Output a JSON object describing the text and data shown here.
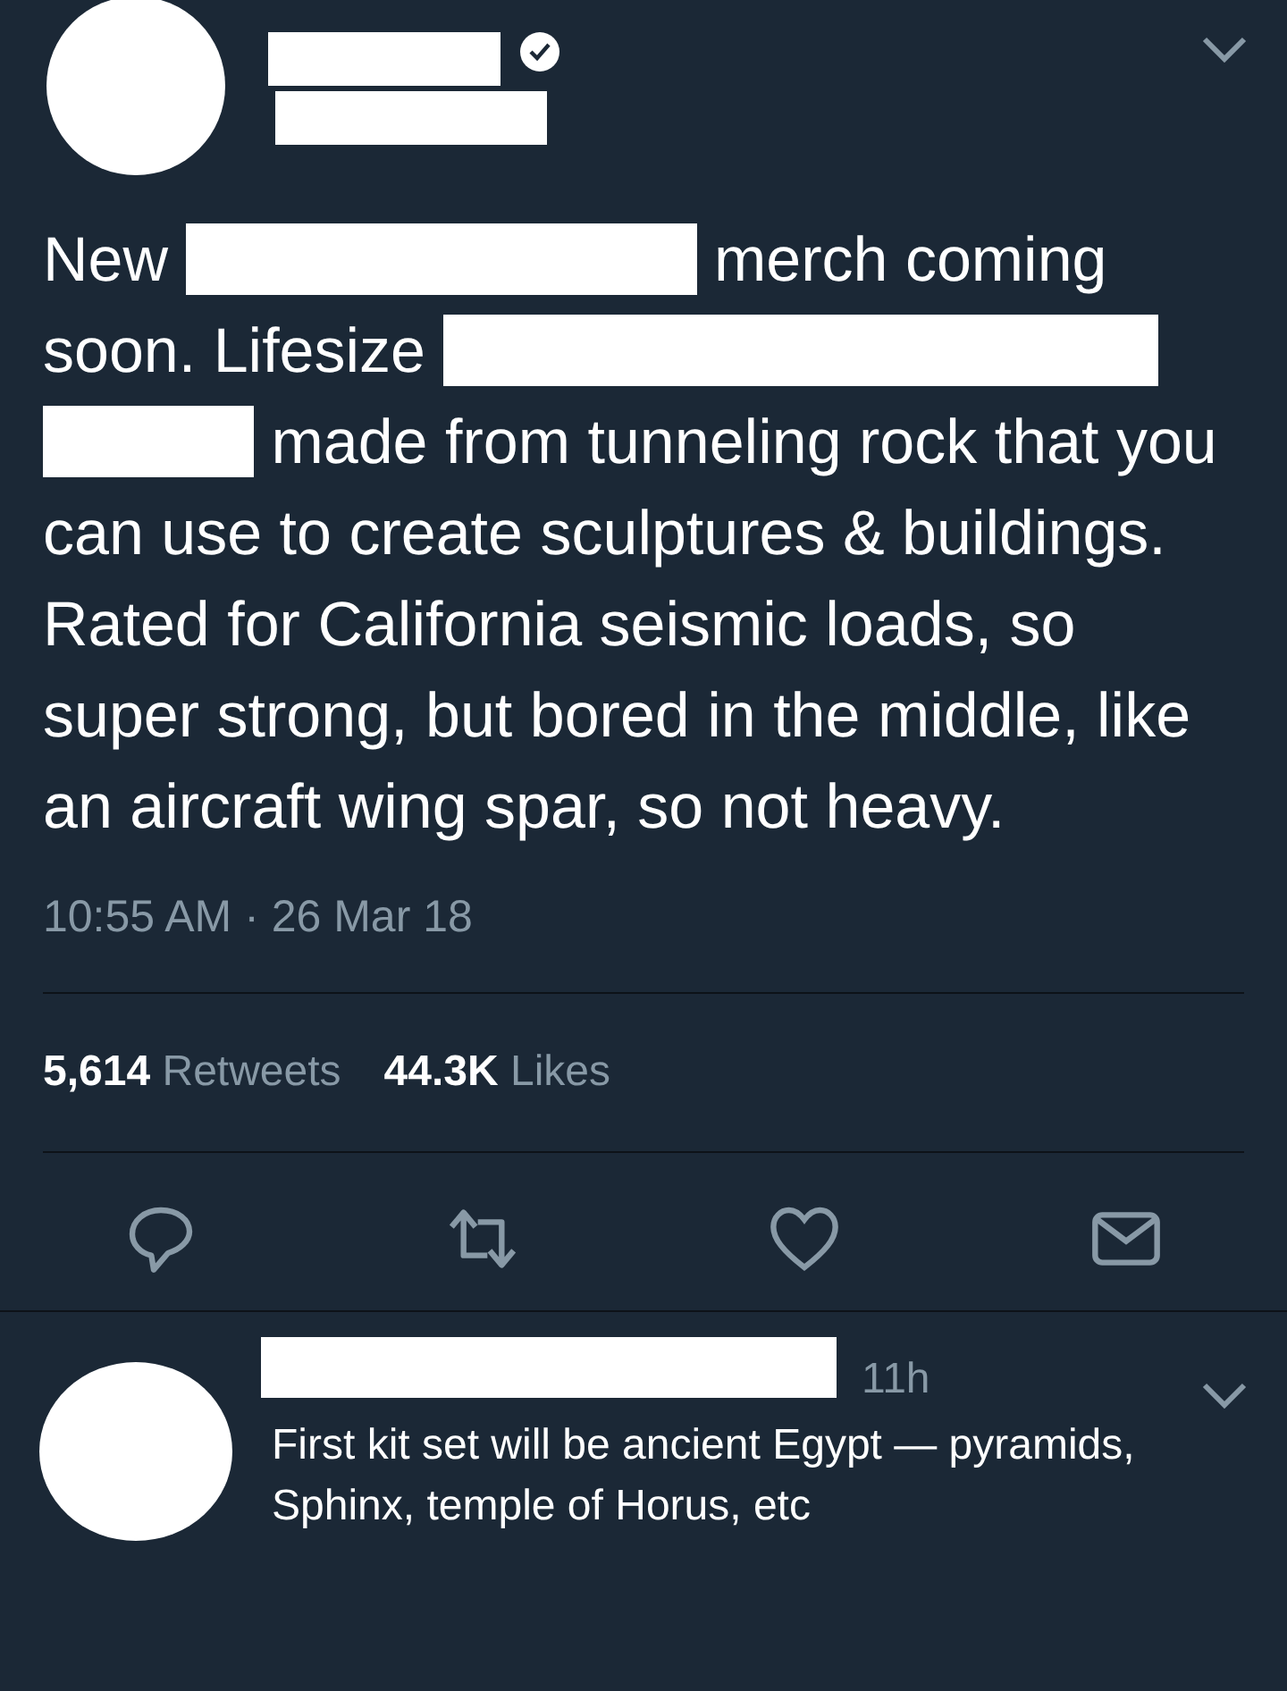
{
  "tweet": {
    "verified": true,
    "body": [
      {
        "kind": "text",
        "text": "New"
      },
      {
        "kind": "redaction"
      },
      {
        "kind": "text",
        "text": "merch coming soon. Lifesize"
      },
      {
        "kind": "redaction"
      },
      {
        "kind": "redaction"
      },
      {
        "kind": "text",
        "text": "made from tunneling rock that you can use to create sculptures & buildings. Rated for California seismic loads, so super strong, but bored in the middle, like an aircraft wing spar, so not heavy."
      }
    ],
    "timestamp": "10:55 AM · 26 Mar 18",
    "stats": [
      {
        "count": "5,614",
        "label": "Retweets"
      },
      {
        "count": "44.3K",
        "label": "Likes"
      }
    ],
    "actions": [
      {
        "kind": "reply"
      },
      {
        "kind": "retweet"
      },
      {
        "kind": "like"
      },
      {
        "kind": "message"
      }
    ]
  },
  "reply": {
    "time": "11h",
    "text": "First kit set will be ancient Egypt — pyramids, Sphinx, temple of Horus, etc"
  }
}
